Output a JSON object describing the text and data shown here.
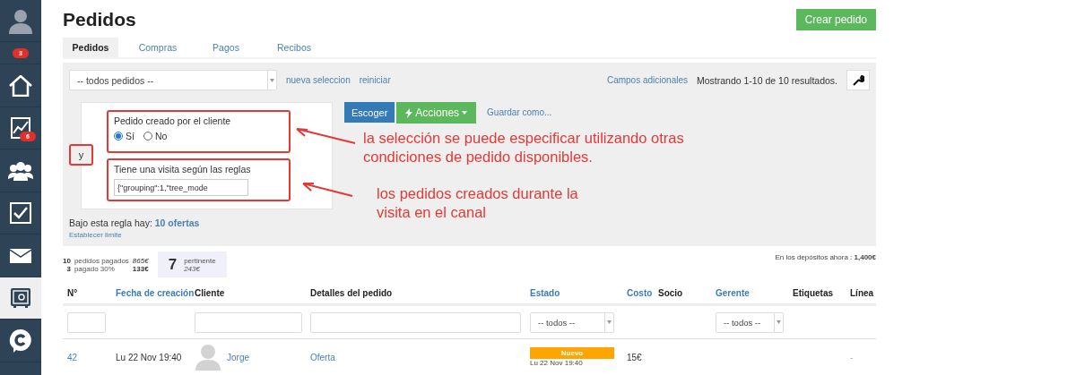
{
  "sidebar": {
    "items": [
      {
        "kind": "avatar",
        "selected": false
      },
      {
        "kind": "badge-row",
        "badge": "3",
        "selected": false
      },
      {
        "kind": "home",
        "selected": false
      },
      {
        "kind": "chart",
        "badge": "6",
        "selected": false
      },
      {
        "kind": "people",
        "selected": false
      },
      {
        "kind": "check",
        "selected": false
      },
      {
        "kind": "mail",
        "selected": false
      },
      {
        "kind": "safe",
        "selected": true
      },
      {
        "kind": "chat",
        "selected": false
      }
    ]
  },
  "title": "Pedidos",
  "create_button": "Crear pedido",
  "tabs": [
    {
      "label": "Pedidos",
      "selected": true
    },
    {
      "label": "Compras",
      "selected": false
    },
    {
      "label": "Pagos",
      "selected": false
    },
    {
      "label": "Recibos",
      "selected": false
    }
  ],
  "filter": {
    "selection": "-- todos pedidos --",
    "links": [
      "nueva seleccion",
      "reiniciar"
    ],
    "extra_fields": "Campos adicionales",
    "showing": "Mostrando 1-10 de 10 resultados.",
    "connector": "y",
    "conditions": [
      {
        "kind": "radio",
        "label": "Pedido creado por el cliente",
        "options": [
          {
            "label": "Sí",
            "selected": true
          },
          {
            "label": "No",
            "selected": false
          }
        ]
      },
      {
        "kind": "text",
        "label": "Tiene una visita según las reglas",
        "value": "{\"grouping\":1,\"tree_mode"
      }
    ],
    "choose_button": "Escoger",
    "actions_button": "Acciones",
    "save_as": "Guardar como...",
    "result_text": "Bajo esta regla hay: ",
    "result_link": "10 ofertas",
    "limit_link": "Establecer limite"
  },
  "annotations": [
    {
      "text": "la selección se puede especificar utilizando otras condiciones de pedido disponibles."
    },
    {
      "text": "los pedidos creados durante la visita en el canal"
    }
  ],
  "stats": {
    "paid": [
      {
        "count": "10",
        "label": "pedidos pagados",
        "amount": "865€",
        "italic": true
      },
      {
        "count": "3",
        "label": "pagado 30%",
        "amount": "133€",
        "italic": false
      }
    ],
    "pertinent": {
      "count": "7",
      "label": "pertinente",
      "amount": "243€"
    },
    "deposits_label": "En los depósitos ahora : ",
    "deposits_value": "1,400€"
  },
  "table": {
    "columns": [
      {
        "label": "N°",
        "sortable": false
      },
      {
        "label": "Fecha de creación",
        "sortable": true
      },
      {
        "label": "Cliente",
        "sortable": false
      },
      {
        "label": "Detalles del pedido",
        "sortable": false
      },
      {
        "label": "Estado",
        "sortable": true
      },
      {
        "label": "Costo",
        "sortable": true
      },
      {
        "label": "Socio",
        "sortable": false
      },
      {
        "label": "Gerente",
        "sortable": true
      },
      {
        "label": "Etiquetas",
        "sortable": false
      },
      {
        "label": "Línea",
        "sortable": false
      }
    ],
    "filters": [
      {
        "kind": "input"
      },
      {
        "kind": "empty"
      },
      {
        "kind": "input"
      },
      {
        "kind": "input"
      },
      {
        "kind": "select",
        "placeholder": "-- todos --"
      },
      {
        "kind": "empty"
      },
      {
        "kind": "empty"
      },
      {
        "kind": "select",
        "placeholder": "-- todos --"
      },
      {
        "kind": "empty"
      },
      {
        "kind": "empty"
      }
    ],
    "rows": [
      {
        "number": "42",
        "date": "Lu 22 Nov 19:40",
        "client": "Jorge",
        "details": "Oferta",
        "status": {
          "label": "Nuevo",
          "color": "#ffa500",
          "date": "Lu 22 Nov 19:40"
        },
        "cost": "15€",
        "line": "-"
      }
    ]
  }
}
